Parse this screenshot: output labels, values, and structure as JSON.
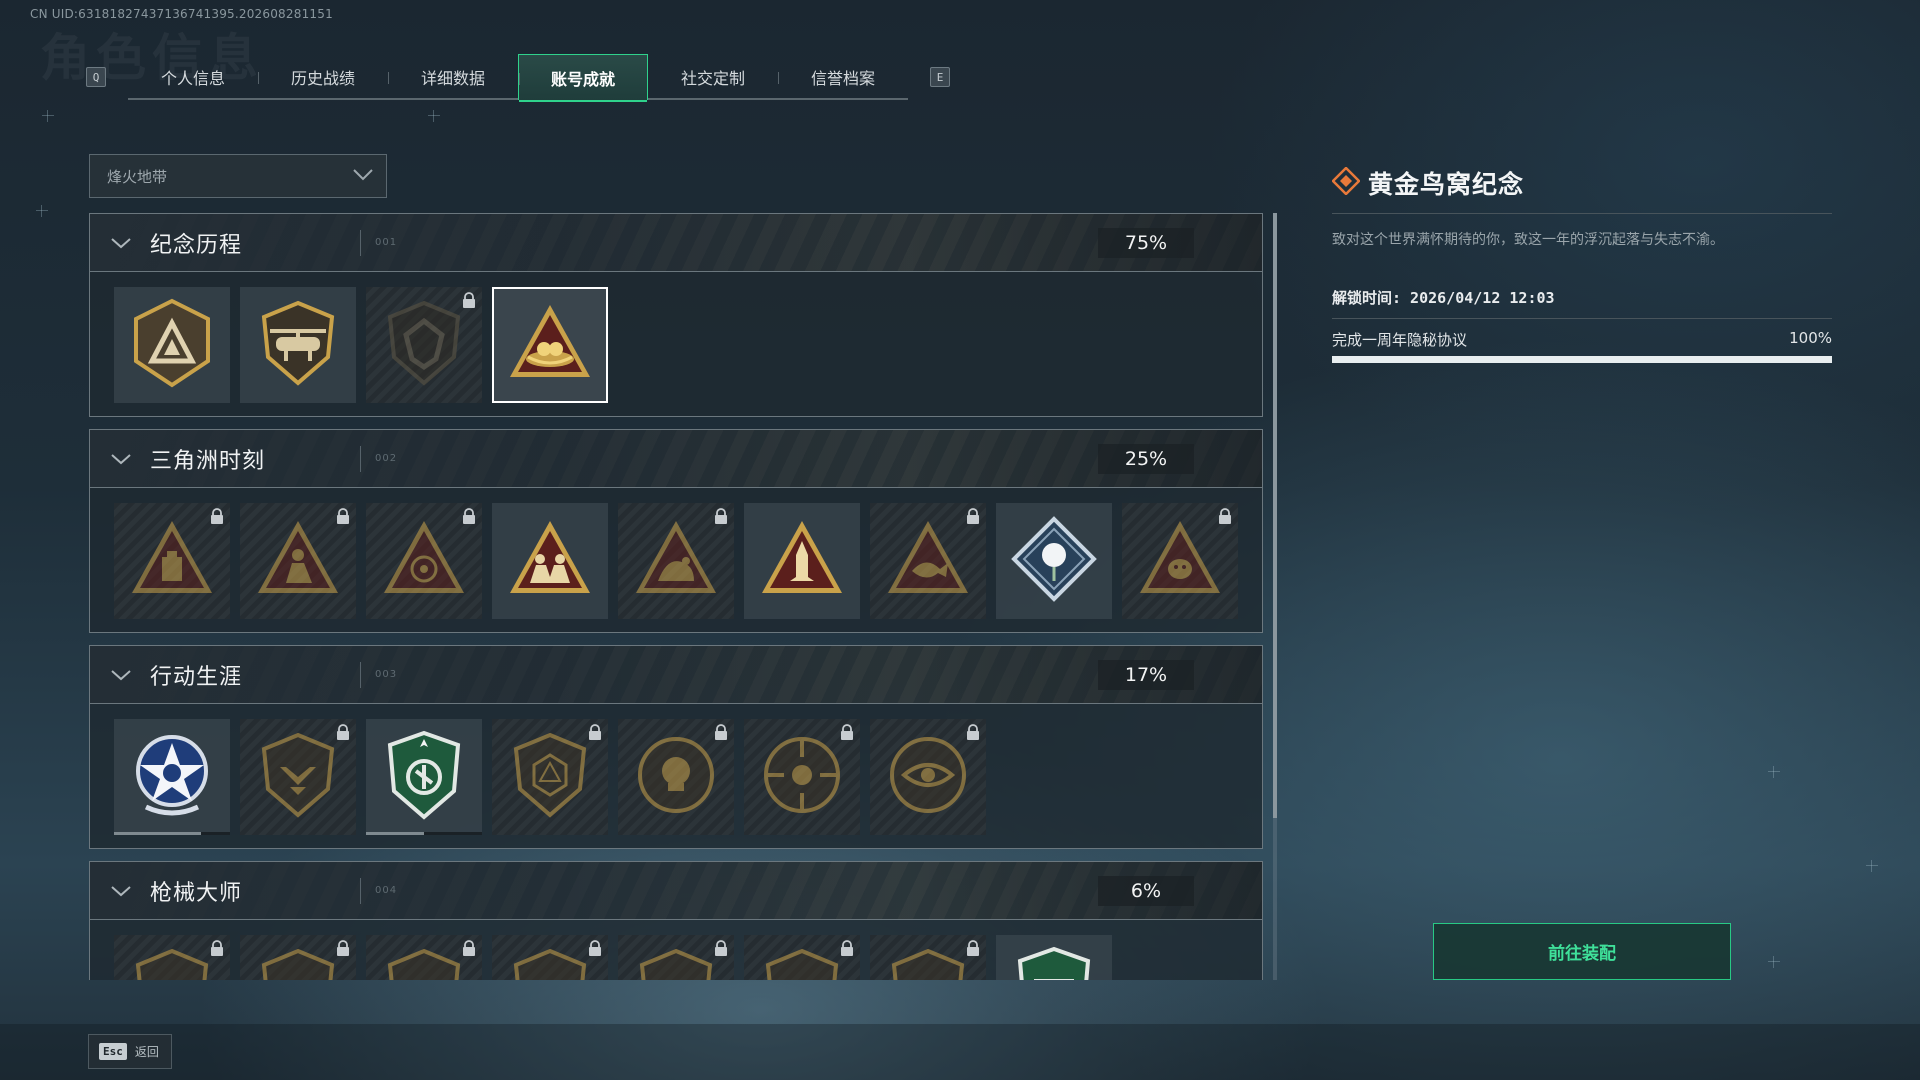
{
  "uid_text": "CN UID:63181827437136741395.202608281151",
  "ghost_title": "角色信息",
  "tabs": {
    "prev_key": "Q",
    "next_key": "E",
    "items": [
      "个人信息",
      "历史战绩",
      "详细数据",
      "账号成就",
      "社交定制",
      "信誉档案"
    ],
    "active_index": 3
  },
  "filter": {
    "selected": "烽火地带"
  },
  "sections": [
    {
      "title": "纪念历程",
      "code": "001",
      "percent": "75%",
      "badges": [
        {
          "icon": "triangle-emblem-icon",
          "locked": false,
          "selected": false
        },
        {
          "icon": "helicopter-shield-icon",
          "locked": false,
          "selected": false
        },
        {
          "icon": "dark-shield-emblem-icon",
          "locked": true,
          "selected": false
        },
        {
          "icon": "golden-nest-triangle-icon",
          "locked": false,
          "selected": true
        }
      ]
    },
    {
      "title": "三角洲时刻",
      "code": "002",
      "percent": "25%",
      "badges": [
        {
          "icon": "triangle-crate-icon",
          "locked": true
        },
        {
          "icon": "triangle-soldier-icon",
          "locked": true
        },
        {
          "icon": "triangle-target-icon",
          "locked": true
        },
        {
          "icon": "triangle-squad-icon",
          "locked": false
        },
        {
          "icon": "triangle-beast-icon",
          "locked": true
        },
        {
          "icon": "triangle-rocket-icon",
          "locked": false
        },
        {
          "icon": "triangle-fish-icon",
          "locked": true
        },
        {
          "icon": "diamond-rose-icon",
          "locked": false
        },
        {
          "icon": "triangle-mask-icon",
          "locked": true
        }
      ]
    },
    {
      "title": "行动生涯",
      "code": "003",
      "percent": "17%",
      "badges": [
        {
          "icon": "blue-star-medal-icon",
          "locked": false,
          "progress": 0.75
        },
        {
          "icon": "wing-shield-icon",
          "locked": true
        },
        {
          "icon": "green-shield-medal-icon",
          "locked": false,
          "progress": 0.5
        },
        {
          "icon": "hex-shield-icon",
          "locked": true
        },
        {
          "icon": "round-skull-icon",
          "locked": true
        },
        {
          "icon": "crosshair-skull-icon",
          "locked": true
        },
        {
          "icon": "eye-medal-icon",
          "locked": true
        }
      ]
    },
    {
      "title": "枪械大师",
      "code": "004",
      "percent": "6%",
      "badges": [
        {
          "icon": "gun-shield-icon",
          "locked": true
        },
        {
          "icon": "gun-shield-icon",
          "locked": true
        },
        {
          "icon": "gun-shield-icon",
          "locked": true
        },
        {
          "icon": "gun-shield-icon",
          "locked": true
        },
        {
          "icon": "gun-shield-icon",
          "locked": true
        },
        {
          "icon": "gun-shield-icon",
          "locked": true
        },
        {
          "icon": "gun-shield-icon",
          "locked": true
        },
        {
          "icon": "green-gun-shield-icon",
          "locked": false
        }
      ]
    }
  ],
  "detail": {
    "title": "黄金鸟窝纪念",
    "description": "致对这个世界满怀期待的你，致这一年的浮沉起落与失志不渝。",
    "unlock_time": "解锁时间: 2026/04/12 12:03",
    "task_label": "完成一周年隐秘协议",
    "task_percent": "100%",
    "task_progress": 1.0
  },
  "equip_button": "前往装配",
  "back": {
    "key": "Esc",
    "label": "返回"
  },
  "colors": {
    "accent_green": "#2fd28c",
    "gold": "#c9a24a",
    "dark_red": "#5b1f1c"
  }
}
